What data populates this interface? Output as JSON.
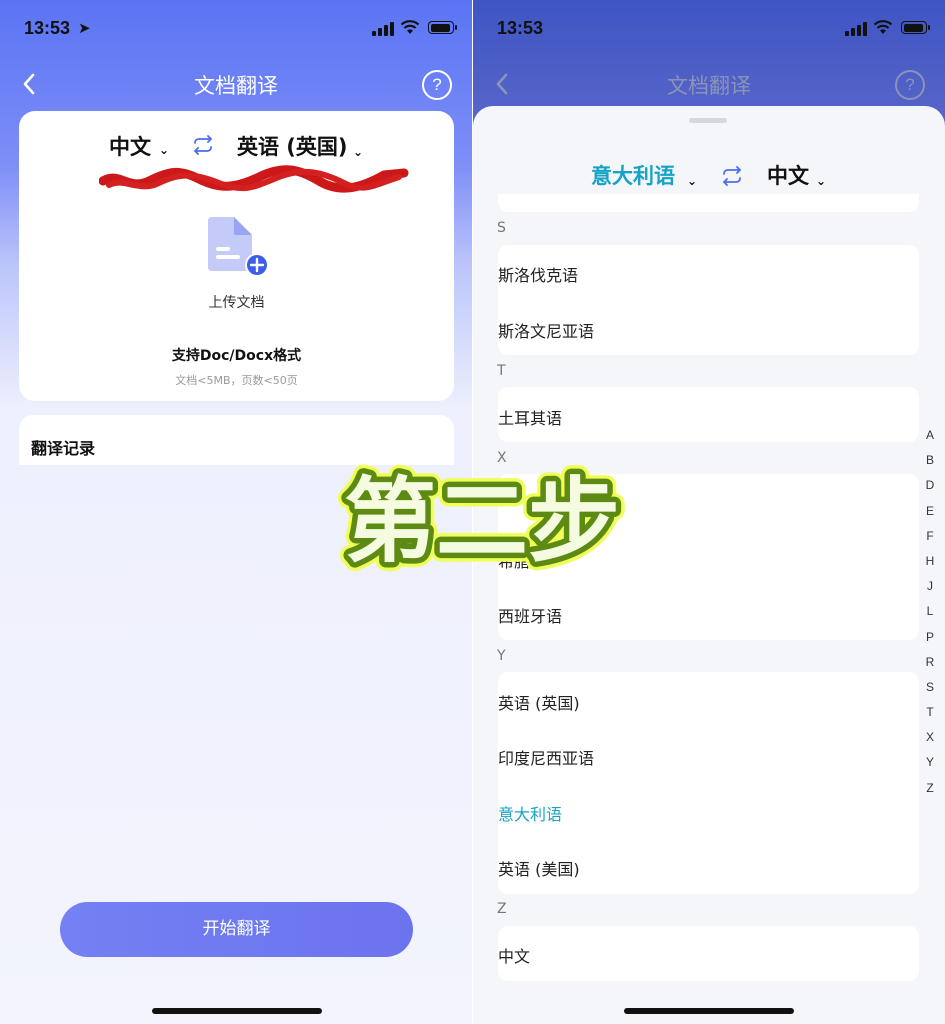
{
  "status": {
    "time": "13:53"
  },
  "left": {
    "nav": {
      "title": "文档翻译",
      "help": "?"
    },
    "source_lang": "中文",
    "target_lang": "英语 (英国)",
    "upload_label": "上传文档",
    "support_text": "支持Doc/Docx格式",
    "limits_text": "文档<5MB，页数<50页",
    "history_title": "翻译记录",
    "start_button": "开始翻译"
  },
  "right": {
    "nav": {
      "title": "文档翻译",
      "help": "?"
    },
    "source_lang": "意大利语",
    "target_lang": "中文",
    "sections": [
      {
        "header": "S",
        "items": [
          "斯洛伐克语",
          "斯洛文尼亚语"
        ]
      },
      {
        "header": "T",
        "items": [
          "土耳其语"
        ]
      },
      {
        "header": "X",
        "items": [
          "希腊语",
          "西班牙语"
        ]
      },
      {
        "header": "Y",
        "items": [
          "英语 (英国)",
          "印度尼西亚语",
          "意大利语",
          "英语 (美国)"
        ]
      },
      {
        "header": "Z",
        "items": [
          "中文"
        ]
      }
    ],
    "selected_item": "意大利语",
    "index_letters": [
      "A",
      "B",
      "D",
      "E",
      "F",
      "H",
      "J",
      "L",
      "P",
      "R",
      "S",
      "T",
      "X",
      "Y",
      "Z"
    ]
  },
  "overlay": {
    "text": "第二步"
  },
  "colors": {
    "accent": "#15a3c6",
    "brand": "#5a74f4",
    "button": "#7480f3",
    "overlay_fill": "#f4fbe0",
    "overlay_stroke": "#5d8a12"
  }
}
